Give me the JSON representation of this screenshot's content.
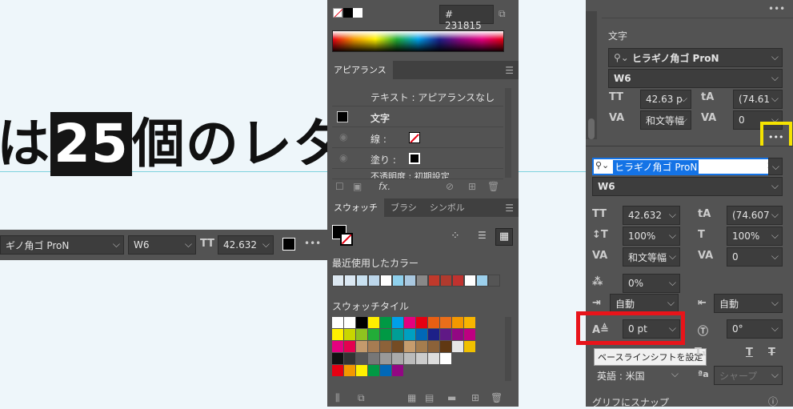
{
  "canvas": {
    "line1": "は",
    "hl": "25",
    "line2": "個のレタ"
  },
  "control_bar": {
    "font": "ギノ角ゴ ProN",
    "weight": "W6",
    "size": "42.632"
  },
  "color_panel": {
    "hex_prefix": "#",
    "hex": "231815"
  },
  "appearance": {
    "tab": "アピアランス",
    "rows": [
      "テキスト : アピアランスなし",
      "文字",
      "線 :",
      "塗り :",
      "不透明度 : 初期設定"
    ],
    "fx": "fx."
  },
  "swatches": {
    "tabs": [
      "スウォッチ",
      "ブラシ",
      "シンボル"
    ],
    "recent_label": "最近使用したカラー",
    "tiles_label": "スウォッチタイル",
    "recent": [
      "#dde8f1",
      "#dbe8f3",
      "#c9e1f0",
      "#bcd6ea",
      "#ffffff",
      "#8fd0ec",
      "#a9c8e0",
      "#888888",
      "#c0392b",
      "#b03a2e",
      "#c0322f",
      "#ffffff",
      "#9cd0ec",
      "#555555"
    ],
    "grid": [
      [
        "#ffffff",
        "#fff",
        "#000000",
        "#ffef00",
        "#009944",
        "#00a0e9",
        "#e4007f",
        "#e60012",
        "#e85f13",
        "#ea6e1a",
        "#f39800",
        "#f8b500"
      ],
      [
        "#fff100",
        "#c9d600",
        "#8fc31f",
        "#22ac38",
        "#009944",
        "#009e96",
        "#00a0c1",
        "#0068b7",
        "#1d2088",
        "#601986",
        "#920783",
        "#be0081"
      ],
      [
        "#e4007f",
        "#e5004f",
        "#c49a6c",
        "#a67c52",
        "#8c6239",
        "#754c24",
        "#c69c6d",
        "#a57d4e",
        "#8c6239",
        "#603813",
        "#e6e6e6",
        "#f0c000"
      ],
      [
        "#111",
        "#333",
        "#555",
        "#777",
        "#999",
        "#aaa",
        "#bbb",
        "#ccc",
        "#ddd",
        "#fff"
      ],
      [
        "#e60012",
        "#f39800",
        "#fff100",
        "#009944",
        "#0068b7",
        "#920783"
      ]
    ]
  },
  "char_panel": {
    "title": "文字",
    "font": "ヒラギノ角ゴ ProN",
    "weight": "W6",
    "size": "42.63 p",
    "leading": "(74.61",
    "kerning": "和文等幅",
    "tracking": "0"
  },
  "popup": {
    "font": "ヒラギノ角ゴ ProN",
    "weight": "W6",
    "size": "42.632",
    "leading": "(74.607",
    "vscale": "100%",
    "hscale": "100%",
    "kerning": "和文等幅",
    "tracking": "0",
    "tsume": "0%",
    "aki1": "自動",
    "aki2": "自動",
    "baseline": "0 pt",
    "rotation": "0°",
    "tooltip": "ベースラインシフトを設定",
    "lang": "英語 : 米国",
    "aa": "シャープ",
    "snap": "グリフにスナップ"
  },
  "colors": {
    "accent": "#1473e6",
    "highlight_red": "#e8141a",
    "highlight_yellow": "#f5e300"
  }
}
